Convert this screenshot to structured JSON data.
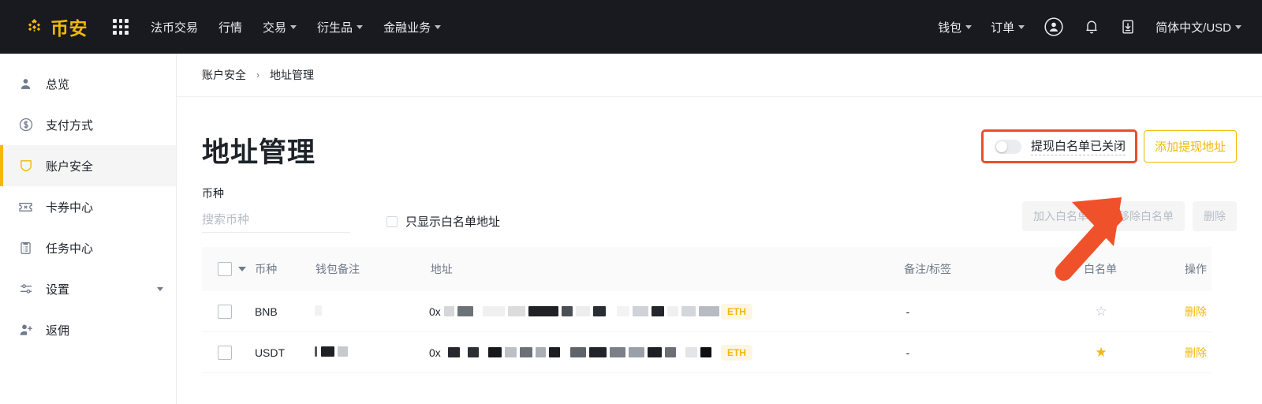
{
  "topnav": {
    "brand": "币安",
    "brand_color": "#f0b90b",
    "apps_icon": "grid-apps-icon",
    "items": [
      {
        "label": "法币交易",
        "has_caret": false
      },
      {
        "label": "行情",
        "has_caret": false
      },
      {
        "label": "交易",
        "has_caret": true
      },
      {
        "label": "衍生品",
        "has_caret": true
      },
      {
        "label": "金融业务",
        "has_caret": true
      }
    ],
    "right_items": [
      {
        "label": "钱包",
        "has_caret": true
      },
      {
        "label": "订单",
        "has_caret": true
      }
    ],
    "icons": [
      "user-circle-icon",
      "bell-icon",
      "download-icon"
    ],
    "locale": "简体中文/USD"
  },
  "sidebar": {
    "items": [
      {
        "label": "总览",
        "icon": "person-icon",
        "active": false,
        "expandable": false
      },
      {
        "label": "支付方式",
        "icon": "dollar-circle-icon",
        "active": false,
        "expandable": false
      },
      {
        "label": "账户安全",
        "icon": "shield-icon",
        "active": true,
        "expandable": false
      },
      {
        "label": "卡券中心",
        "icon": "ticket-icon",
        "active": false,
        "expandable": false
      },
      {
        "label": "任务中心",
        "icon": "clipboard-icon",
        "active": false,
        "expandable": false
      },
      {
        "label": "设置",
        "icon": "sliders-icon",
        "active": false,
        "expandable": true
      },
      {
        "label": "返佣",
        "icon": "person-add-icon",
        "active": false,
        "expandable": false
      }
    ]
  },
  "breadcrumb": {
    "parent": "账户安全",
    "separator": "›",
    "current": "地址管理"
  },
  "header": {
    "title": "地址管理",
    "toggle_label": "提现白名单已关闭",
    "toggle_on": false,
    "toggle_highlight_color": "#e8502a",
    "add_button": "添加提现地址",
    "accent_color": "#f0b90b"
  },
  "annotation": {
    "arrow": "orange-arrow-pointing-to-toggle",
    "color": "#ef522b"
  },
  "filters": {
    "coin_label": "币种",
    "coin_placeholder": "搜索币种",
    "coin_value": "",
    "whitelist_only_label": "只显示白名单地址",
    "whitelist_only_checked": false,
    "actions": [
      {
        "label": "加入白名单",
        "disabled": true
      },
      {
        "label": "移除白名单",
        "disabled": true
      },
      {
        "label": "删除",
        "disabled": true
      }
    ]
  },
  "table": {
    "columns": [
      "币种",
      "钱包备注",
      "地址",
      "备注/标签",
      "白名单",
      "操作"
    ],
    "select_all_checked": false,
    "rows": [
      {
        "checked": false,
        "coin": "BNB",
        "note_redacted": true,
        "address_prefix": "0x",
        "address_redacted": true,
        "address_truncated": false,
        "network": "ETH",
        "tag": "-",
        "whitelisted": false,
        "action": "删除"
      },
      {
        "checked": false,
        "coin": "USDT",
        "note_redacted": true,
        "address_prefix": "0x",
        "address_redacted": true,
        "address_truncated": true,
        "address_ellipsis": "...",
        "network": "ETH",
        "tag": "-",
        "whitelisted": true,
        "action": "删除"
      }
    ]
  }
}
